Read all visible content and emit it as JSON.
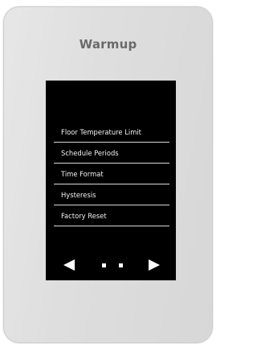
{
  "brand": "Warmup",
  "menu": {
    "items": [
      {
        "label": "Floor Temperature Limit"
      },
      {
        "label": "Schedule Periods"
      },
      {
        "label": "Time Format"
      },
      {
        "label": "Hysteresis"
      },
      {
        "label": "Factory Reset"
      }
    ]
  },
  "pagination": {
    "page_count": 2,
    "icons": {
      "prev": "triangle-left-icon",
      "next": "triangle-right-icon"
    }
  },
  "colors": {
    "device_body": "#dedede",
    "screen": "#000000",
    "text": "#f2f2f2",
    "brand": "#6a6a6a"
  }
}
